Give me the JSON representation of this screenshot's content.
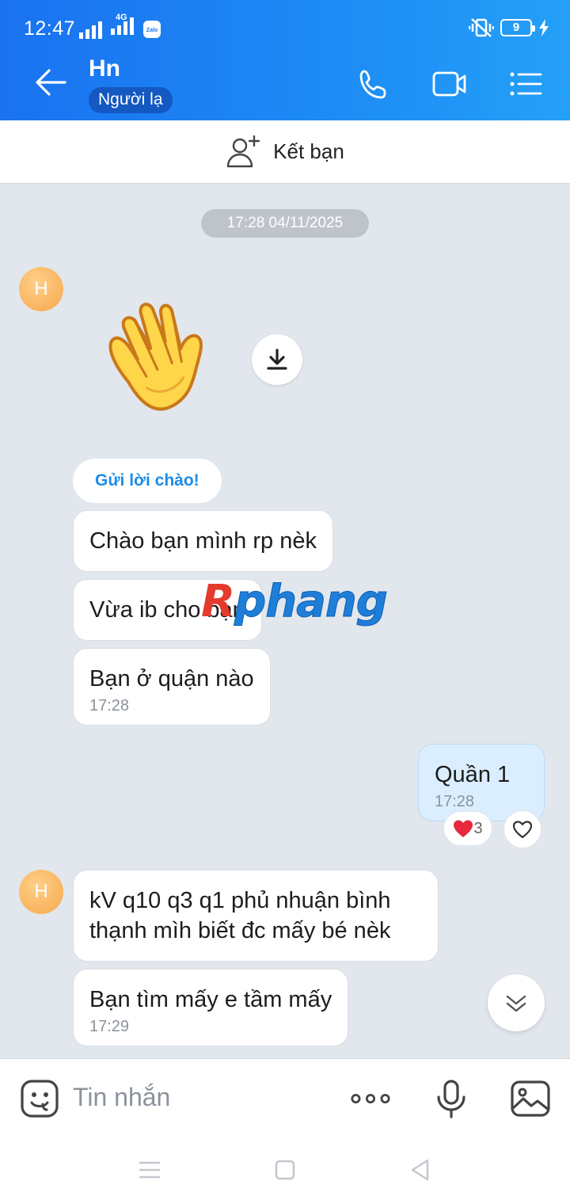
{
  "status_bar": {
    "time": "12:47",
    "network": "4G",
    "battery": "9"
  },
  "header": {
    "contact_name": "Hn",
    "contact_status": "Người lạ"
  },
  "friend_bar": {
    "label": "Kết bạn"
  },
  "chat": {
    "date_separator": "17:28 04/11/2025",
    "avatar_initial": "H",
    "greeting_button": "Gửi lời chào!",
    "messages": [
      {
        "text": "Chào bạn mình rp nèk",
        "time": ""
      },
      {
        "text": "Vừa ib cho bạn",
        "time": ""
      },
      {
        "text": "Bạn ở quận nào",
        "time": "17:28"
      },
      {
        "text": "Quần 1",
        "time": "17:28",
        "mine": true,
        "reaction_count": "3"
      },
      {
        "text": "kV q10 q3 q1 phủ nhuận bình thạnh mìh biết đc mấy bé nèk",
        "time": ""
      },
      {
        "text": "Bạn tìm mấy e tầm mấy",
        "time": "17:29"
      }
    ]
  },
  "watermark": {
    "first": "R",
    "rest": "phang"
  },
  "input_bar": {
    "placeholder": "Tin nhắn"
  },
  "colors": {
    "header_blue": "#1d8cf5",
    "mine_bubble": "#dbeeff",
    "greeting_text": "#1c8ce8"
  }
}
